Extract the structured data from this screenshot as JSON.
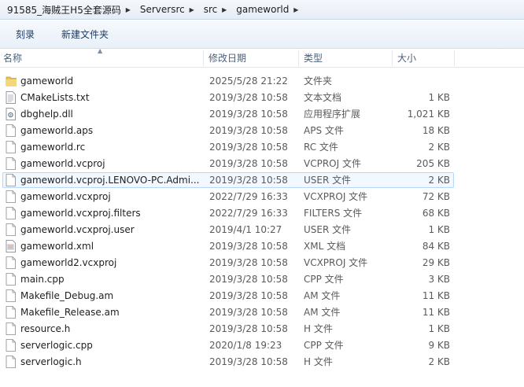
{
  "breadcrumb": [
    "91585_海贼王H5全套源码",
    "Serversrc",
    "src",
    "gameworld"
  ],
  "toolbar": {
    "burn_label": "刻录",
    "new_folder_label": "新建文件夹"
  },
  "columns": {
    "name": "名称",
    "date": "修改日期",
    "type": "类型",
    "size": "大小"
  },
  "files": [
    {
      "name": "gameworld",
      "date": "2025/5/28 21:22",
      "type": "文件夹",
      "size": "",
      "icon": "folder-icon"
    },
    {
      "name": "CMakeLists.txt",
      "date": "2019/3/28 10:58",
      "type": "文本文档",
      "size": "1 KB",
      "icon": "text-file-icon"
    },
    {
      "name": "dbghelp.dll",
      "date": "2019/3/28 10:58",
      "type": "应用程序扩展",
      "size": "1,021 KB",
      "icon": "dll-file-icon"
    },
    {
      "name": "gameworld.aps",
      "date": "2019/3/28 10:58",
      "type": "APS 文件",
      "size": "18 KB",
      "icon": "file-icon"
    },
    {
      "name": "gameworld.rc",
      "date": "2019/3/28 10:58",
      "type": "RC 文件",
      "size": "2 KB",
      "icon": "file-icon"
    },
    {
      "name": "gameworld.vcproj",
      "date": "2019/3/28 10:58",
      "type": "VCPROJ 文件",
      "size": "205 KB",
      "icon": "file-icon"
    },
    {
      "name": "gameworld.vcproj.LENOVO-PC.Admi...",
      "date": "2019/3/28 10:58",
      "type": "USER 文件",
      "size": "2 KB",
      "icon": "file-icon"
    },
    {
      "name": "gameworld.vcxproj",
      "date": "2022/7/29 16:33",
      "type": "VCXPROJ 文件",
      "size": "72 KB",
      "icon": "file-icon"
    },
    {
      "name": "gameworld.vcxproj.filters",
      "date": "2022/7/29 16:33",
      "type": "FILTERS 文件",
      "size": "68 KB",
      "icon": "file-icon"
    },
    {
      "name": "gameworld.vcxproj.user",
      "date": "2019/4/1 10:27",
      "type": "USER 文件",
      "size": "1 KB",
      "icon": "file-icon"
    },
    {
      "name": "gameworld.xml",
      "date": "2019/3/28 10:58",
      "type": "XML 文档",
      "size": "84 KB",
      "icon": "xml-file-icon"
    },
    {
      "name": "gameworld2.vcxproj",
      "date": "2019/3/28 10:58",
      "type": "VCXPROJ 文件",
      "size": "29 KB",
      "icon": "file-icon"
    },
    {
      "name": "main.cpp",
      "date": "2019/3/28 10:58",
      "type": "CPP 文件",
      "size": "3 KB",
      "icon": "file-icon"
    },
    {
      "name": "Makefile_Debug.am",
      "date": "2019/3/28 10:58",
      "type": "AM 文件",
      "size": "11 KB",
      "icon": "file-icon"
    },
    {
      "name": "Makefile_Release.am",
      "date": "2019/3/28 10:58",
      "type": "AM 文件",
      "size": "11 KB",
      "icon": "file-icon"
    },
    {
      "name": "resource.h",
      "date": "2019/3/28 10:58",
      "type": "H 文件",
      "size": "1 KB",
      "icon": "file-icon"
    },
    {
      "name": "serverlogic.cpp",
      "date": "2020/1/8 19:23",
      "type": "CPP 文件",
      "size": "9 KB",
      "icon": "file-icon"
    },
    {
      "name": "serverlogic.h",
      "date": "2019/3/28 10:58",
      "type": "H 文件",
      "size": "2 KB",
      "icon": "file-icon"
    }
  ],
  "highlighted_row": 6,
  "colors": {
    "highlight_border": "#b8d6fb",
    "highlight_fill": "#f2f8ff",
    "folder": "#e8c25a"
  }
}
